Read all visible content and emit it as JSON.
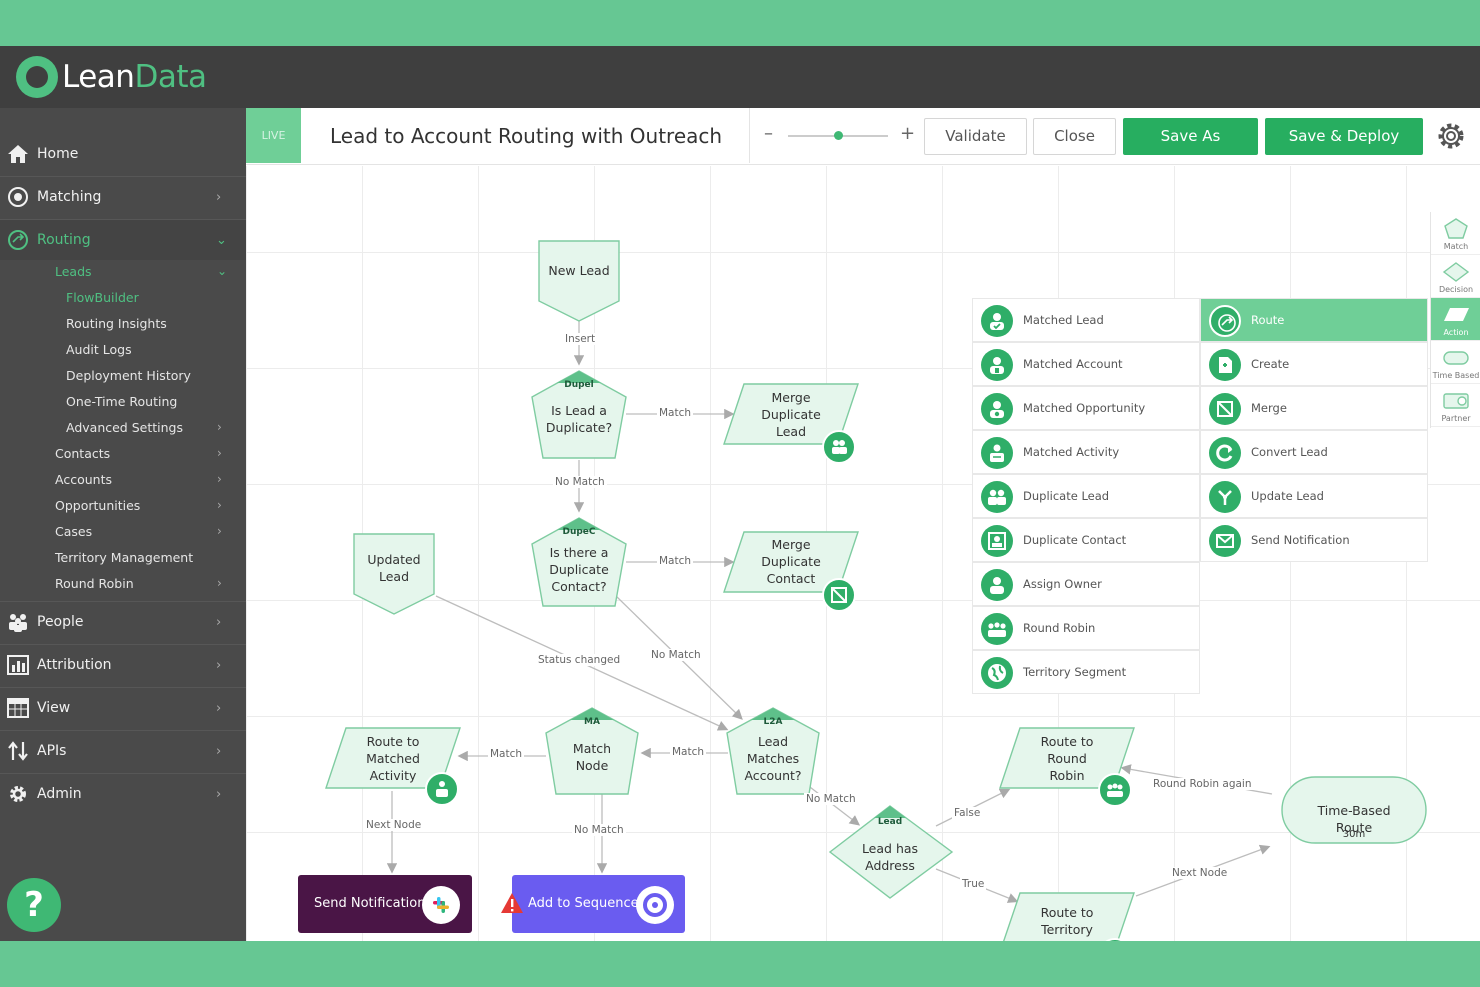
{
  "brand": {
    "logo_part1": "Lean",
    "logo_part2": "Data"
  },
  "sidebar": {
    "items": [
      {
        "label": "Home"
      },
      {
        "label": "Matching"
      },
      {
        "label": "Routing"
      },
      {
        "label": "People"
      },
      {
        "label": "Attribution"
      },
      {
        "label": "View"
      },
      {
        "label": "APIs"
      },
      {
        "label": "Admin"
      }
    ],
    "routing_sub": [
      {
        "label": "Leads"
      },
      {
        "label": "FlowBuilder"
      },
      {
        "label": "Routing Insights"
      },
      {
        "label": "Audit Logs"
      },
      {
        "label": "Deployment History"
      },
      {
        "label": "One-Time Routing"
      },
      {
        "label": "Advanced Settings"
      },
      {
        "label": "Contacts"
      },
      {
        "label": "Accounts"
      },
      {
        "label": "Opportunities"
      },
      {
        "label": "Cases"
      },
      {
        "label": "Territory Management"
      },
      {
        "label": "Round Robin"
      }
    ],
    "help_label": "?"
  },
  "header": {
    "live_label": "LIVE",
    "title": "Lead to Account Routing with Outreach",
    "zoom_minus": "–",
    "zoom_plus": "+",
    "zoom_level": 0.5,
    "validate_label": "Validate",
    "close_label": "Close",
    "save_as_label": "Save As",
    "save_deploy_label": "Save & Deploy"
  },
  "colors": {
    "brand_green": "#4fc082",
    "button_green": "#27ae60",
    "node_fill": "#e5f6ec",
    "node_stroke": "#7fcca1",
    "outreach_purple": "#6a5cf0",
    "slack_dark": "#4a1546"
  },
  "flow": {
    "nodes": {
      "new_lead": "New Lead",
      "dupe_lead": "Is Lead a Duplicate?",
      "merge_lead": "Merge Duplicate Lead",
      "dupe_contact": "Is there a Duplicate Contact?",
      "merge_contact": "Merge Duplicate Contact",
      "updated_lead": "Updated Lead",
      "l2a": "Lead Matches Account?",
      "match_node": "Match Node",
      "route_activity": "Route to Matched Activity",
      "send_notification": "Send Notification",
      "add_sequence": "Add to Sequence",
      "lead_address": "Lead has Address",
      "route_rr": "Route to Round Robin",
      "route_territory": "Route to Territory",
      "time_based": "Time-Based Route",
      "time_based_sub": "30m"
    },
    "tags": {
      "dupe1": "Dupel",
      "dupe2": "DupeC",
      "l2a": "L2A",
      "ma": "MA",
      "lead": "Lead"
    },
    "edges": {
      "insert": "Insert",
      "match1": "Match",
      "no_match1": "No Match",
      "match2": "Match",
      "status_changed": "Status changed",
      "no_match2": "No Match",
      "match3": "Match",
      "match4": "Match",
      "next_node1": "Next Node",
      "no_match3": "No Match",
      "no_match4": "No Match",
      "false_lbl": "False",
      "true_lbl": "True",
      "rr_again": "Round Robin again",
      "next_node2": "Next Node"
    }
  },
  "palette": {
    "left": [
      {
        "label": "Matched Lead",
        "icon": "person-check-icon"
      },
      {
        "label": "Matched Account",
        "icon": "person-building-icon"
      },
      {
        "label": "Matched Opportunity",
        "icon": "person-dollar-icon"
      },
      {
        "label": "Matched Activity",
        "icon": "person-activity-icon"
      },
      {
        "label": "Duplicate Lead",
        "icon": "people-icon"
      },
      {
        "label": "Duplicate Contact",
        "icon": "contact-card-icon"
      },
      {
        "label": "Assign Owner",
        "icon": "person-icon"
      },
      {
        "label": "Round Robin",
        "icon": "group-icon"
      },
      {
        "label": "Territory Segment",
        "icon": "globe-icon"
      }
    ],
    "right": [
      {
        "label": "Route",
        "icon": "route-icon"
      },
      {
        "label": "Create",
        "icon": "create-icon"
      },
      {
        "label": "Merge",
        "icon": "merge-icon"
      },
      {
        "label": "Convert Lead",
        "icon": "convert-icon"
      },
      {
        "label": "Update Lead",
        "icon": "update-icon"
      },
      {
        "label": "Send Notification",
        "icon": "mail-icon"
      }
    ]
  },
  "shapes": [
    {
      "label": "Match"
    },
    {
      "label": "Decision"
    },
    {
      "label": "Action"
    },
    {
      "label": "Time Based"
    },
    {
      "label": "Partner"
    }
  ]
}
